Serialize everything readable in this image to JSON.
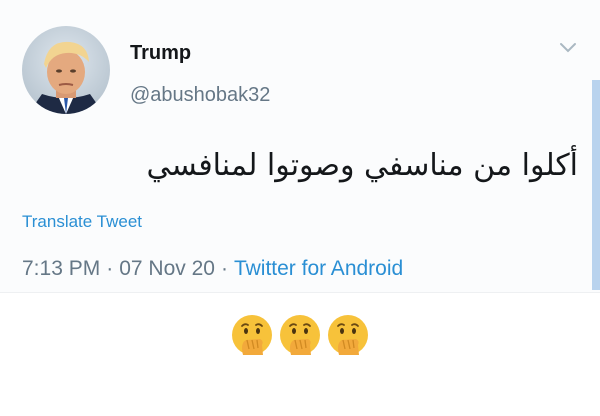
{
  "tweet": {
    "display_name": "Trump",
    "handle": "@abushobak32",
    "text": "أكلوا من مناسفي وصوتوا لمنافسي",
    "translate_label": "Translate Tweet",
    "time": "7:13 PM",
    "date": "07 Nov 20",
    "separator": "·",
    "source": "Twitter for Android",
    "avatar_icon": "profile-photo",
    "menu_icon": "chevron-down-icon"
  },
  "reaction": {
    "emoji_icon": "hand-over-mouth-emoji",
    "emoji": [
      "🤭",
      "🤭",
      "🤭"
    ]
  },
  "colors": {
    "link": "#2a8fd4",
    "secondary_text": "#657786",
    "primary_text": "#14171a",
    "accent_bar": "#b9d3ee"
  }
}
